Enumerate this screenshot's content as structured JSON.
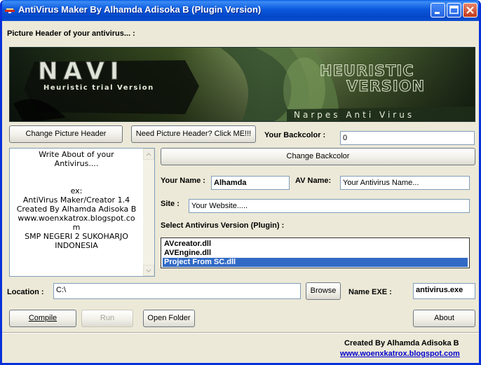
{
  "window": {
    "title": "AntiVirus Maker By Alhamda Adisoka B (Plugin Version)"
  },
  "header_section": {
    "label": "Picture Header of your antivirus... :",
    "image": {
      "logo_text": "NAVI",
      "tagline": "Heuristic trial Version",
      "side_line1": "HEURISTIC",
      "side_line2": "VERSION",
      "banner": "Narpes Anti Virus"
    }
  },
  "buttons": {
    "change_picture": "Change Picture Header",
    "need_picture": "Need Picture Header? Click ME!!!",
    "change_backcolor": "Change Backcolor",
    "browse": "Browse",
    "compile": "Compile",
    "run": "Run",
    "open_folder": "Open Folder",
    "about": "About"
  },
  "backcolor": {
    "label": "Your Backcolor :",
    "value": "0"
  },
  "about_memo": {
    "lines": [
      "Write About of your",
      "Antivirus....",
      "",
      "",
      "ex:",
      "AntiVirus Maker/Creator 1.4",
      "Created By Alhamda Adisoka B",
      "www.woenxkatrox.blogspot.co",
      "m",
      "SMP NEGERI 2 SUKOHARJO",
      "INDONESIA"
    ]
  },
  "form": {
    "your_name_label": "Your Name :",
    "your_name_value": "Alhamda",
    "av_name_label": "AV Name:",
    "av_name_value": "Your Antivirus Name...",
    "site_label": "Site :",
    "site_value": "Your Website.....",
    "version_label": "Select Antivirus Version (Plugin) :",
    "versions": [
      "AVcreator.dll",
      "AVEngine.dll",
      "Project From SC.dll"
    ],
    "selected_version": "Project From SC.dll"
  },
  "location": {
    "label": "Location :",
    "value": "C:\\"
  },
  "exe": {
    "label": "Name EXE :",
    "value": "antivirus.exe"
  },
  "footer": {
    "credit": "Created By Alhamda Adisoka B",
    "link": "www.woenxkatrox.blogspot.com"
  },
  "colors": {
    "titlebar": "#0a58dc",
    "window_bg": "#ece9d8",
    "selection": "#316ac5",
    "link": "#0000cc"
  }
}
